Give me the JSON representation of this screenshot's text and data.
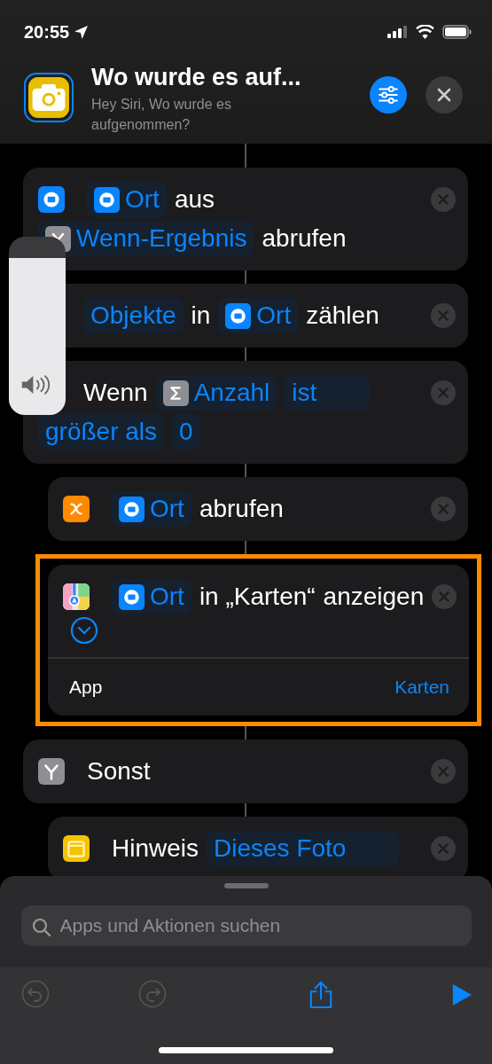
{
  "status_bar": {
    "time": "20:55"
  },
  "header": {
    "title": "Wo wurde es auf...",
    "subtitle": "Hey Siri, Wo wurde es aufgenommen?"
  },
  "volume_hud": {
    "level": 0.88
  },
  "actions": [
    {
      "kind": "get-photo-detail",
      "selected": false,
      "tokens": [
        {
          "kind": "photo-variable",
          "text": "Ort"
        },
        {
          "kind": "text",
          "text": "aus"
        },
        {
          "kind": "if-variable",
          "text": "Wenn-Ergebnis"
        },
        {
          "kind": "text",
          "text": "abrufen"
        }
      ]
    },
    {
      "kind": "count",
      "selected": false,
      "tokens": [
        {
          "kind": "param",
          "text": "Objekte"
        },
        {
          "kind": "text",
          "text": "in"
        },
        {
          "kind": "photo-variable",
          "text": "Ort"
        },
        {
          "kind": "text",
          "text": "zählen"
        }
      ]
    },
    {
      "kind": "if",
      "selected": false,
      "tokens": [
        {
          "kind": "text",
          "text": "Wenn"
        },
        {
          "kind": "sum-variable",
          "text": "Anzahl"
        },
        {
          "kind": "list-param",
          "text": "ist"
        },
        {
          "kind": "param",
          "text": "größer als"
        },
        {
          "kind": "param",
          "text": "0"
        }
      ],
      "children": [
        {
          "kind": "get-variable",
          "selected": false,
          "tokens": [
            {
              "kind": "photo-variable",
              "text": "Ort"
            },
            {
              "kind": "text",
              "text": "abrufen"
            }
          ]
        },
        {
          "kind": "show-in-maps",
          "selected": true,
          "expanded": false,
          "tokens": [
            {
              "kind": "photo-variable",
              "text": "Ort"
            },
            {
              "kind": "text",
              "text": "in „Karten“"
            },
            {
              "kind": "text",
              "text": "anzeigen"
            }
          ],
          "params": [
            {
              "label": "App",
              "value": "Karten"
            }
          ]
        }
      ]
    },
    {
      "kind": "else",
      "selected": false,
      "tokens": [
        {
          "kind": "text",
          "text": "Sonst"
        }
      ],
      "children": [
        {
          "kind": "note",
          "selected": false,
          "tokens": [
            {
              "kind": "text",
              "text": "Hinweis"
            },
            {
              "kind": "list-param",
              "text": "Dieses Foto"
            }
          ]
        }
      ]
    }
  ],
  "search": {
    "placeholder": "Apps und Aktionen suchen"
  },
  "toolbar": [
    {
      "kind": "undo",
      "disabled": true
    },
    {
      "kind": "redo",
      "disabled": true
    },
    {
      "kind": "share",
      "disabled": false
    },
    {
      "kind": "run",
      "disabled": false
    }
  ]
}
